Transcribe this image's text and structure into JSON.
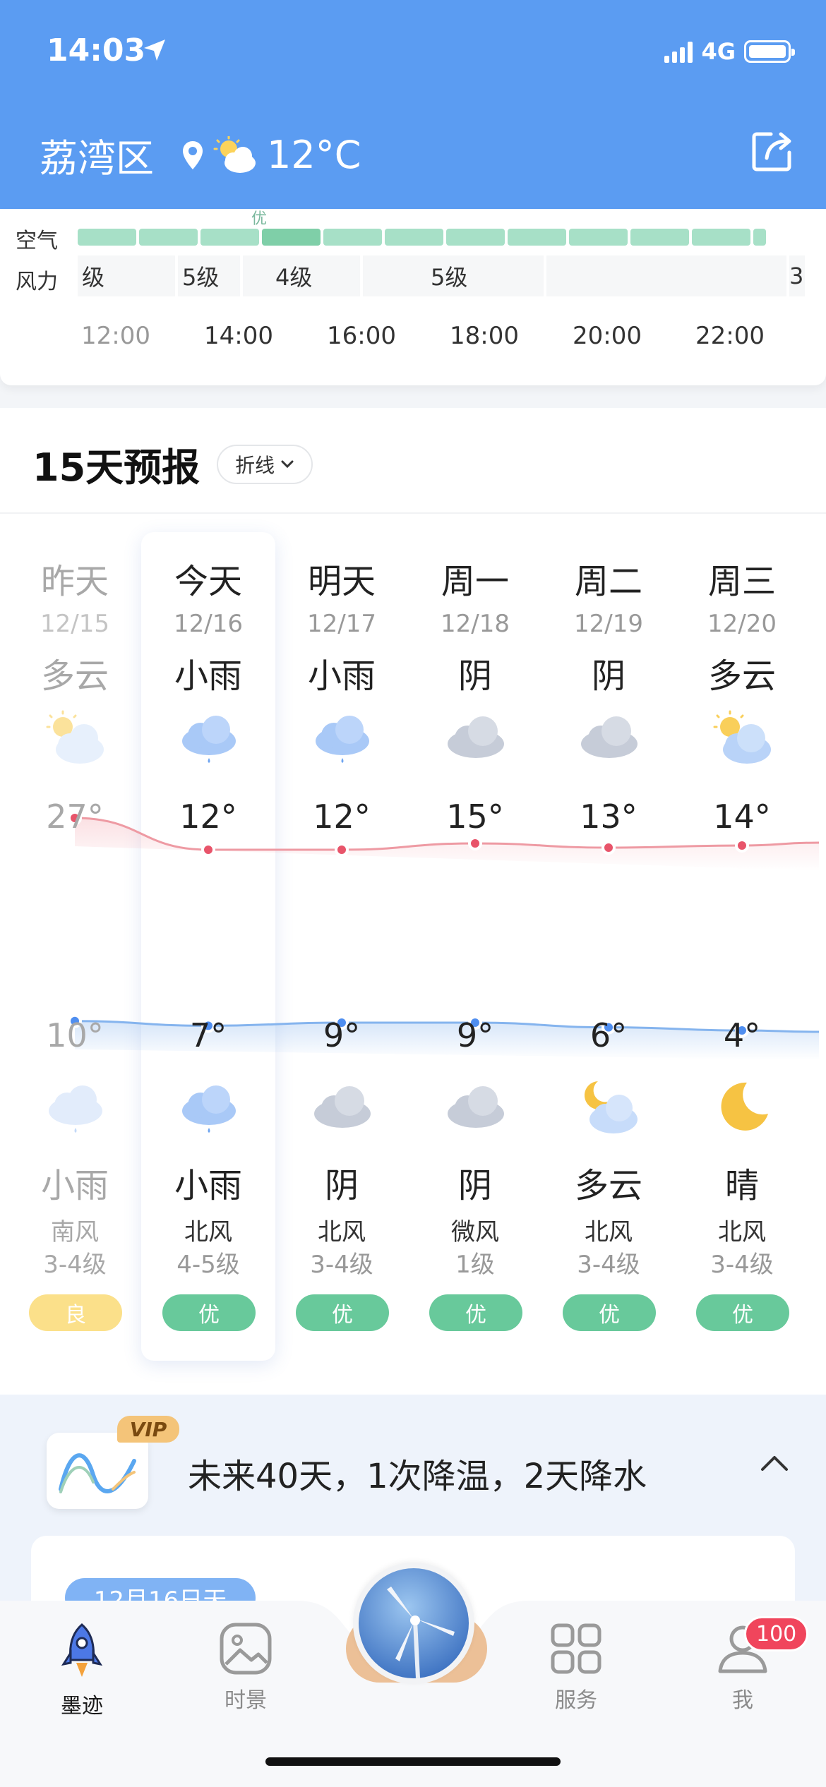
{
  "status_bar": {
    "time": "14:03",
    "network": "4G"
  },
  "header": {
    "location": "荔湾区",
    "temperature": "12°C"
  },
  "hourly": {
    "aq_peek_label": "优",
    "row_labels": {
      "air": "空气",
      "wind": "风力"
    },
    "wind_segments": [
      "级",
      "5级",
      "4级",
      "5级",
      "",
      "3"
    ],
    "hours": [
      "12:00",
      "14:00",
      "16:00",
      "18:00",
      "20:00",
      "22:00"
    ]
  },
  "forecast": {
    "title": "15天预报",
    "mode_label": "折线",
    "days": [
      {
        "name": "昨天",
        "date": "12/15",
        "day_cond": "多云",
        "day_icon": "partly-cloudy-icon",
        "high": "27°",
        "low": "10°",
        "night_cond": "小雨",
        "night_icon": "light-rain-icon",
        "wind_dir": "南风",
        "wind_level": "3-4级",
        "aqi": "良"
      },
      {
        "name": "今天",
        "date": "12/16",
        "day_cond": "小雨",
        "day_icon": "light-rain-icon",
        "high": "12°",
        "low": "7°",
        "night_cond": "小雨",
        "night_icon": "light-rain-icon",
        "wind_dir": "北风",
        "wind_level": "4-5级",
        "aqi": "优"
      },
      {
        "name": "明天",
        "date": "12/17",
        "day_cond": "小雨",
        "day_icon": "light-rain-icon",
        "high": "12°",
        "low": "9°",
        "night_cond": "阴",
        "night_icon": "overcast-icon",
        "wind_dir": "北风",
        "wind_level": "3-4级",
        "aqi": "优"
      },
      {
        "name": "周一",
        "date": "12/18",
        "day_cond": "阴",
        "day_icon": "overcast-icon",
        "high": "15°",
        "low": "9°",
        "night_cond": "阴",
        "night_icon": "overcast-icon",
        "wind_dir": "微风",
        "wind_level": "1级",
        "aqi": "优"
      },
      {
        "name": "周二",
        "date": "12/19",
        "day_cond": "阴",
        "day_icon": "overcast-icon",
        "high": "13°",
        "low": "6°",
        "night_cond": "多云",
        "night_icon": "night-partly-cloudy-icon",
        "wind_dir": "北风",
        "wind_level": "3-4级",
        "aqi": "优"
      },
      {
        "name": "周三",
        "date": "12/20",
        "day_cond": "多云",
        "day_icon": "partly-cloudy-icon",
        "high": "14°",
        "low": "4°",
        "night_cond": "晴",
        "night_icon": "moon-icon",
        "wind_dir": "北风",
        "wind_level": "3-4级",
        "aqi": "优"
      }
    ],
    "high_values": [
      27,
      12,
      12,
      15,
      13,
      14
    ],
    "low_values": [
      10,
      7,
      9,
      9,
      6,
      4
    ],
    "colors": {
      "high_line": "#ee9aa3",
      "high_dot": "#e8546a",
      "low_line": "#85b4ee",
      "low_dot": "#4f8ef0",
      "aqi_good": "#fbe08a",
      "aqi_excellent": "#68c99b"
    }
  },
  "long_range": {
    "vip_label": "VIP",
    "summary": "未来40天，1次降温，2天降水",
    "pill_text": "12月16日天"
  },
  "tabbar": {
    "tabs": [
      {
        "label": "墨迹",
        "icon": "rocket-icon"
      },
      {
        "label": "时景",
        "icon": "image-icon"
      },
      {
        "label": "服务",
        "icon": "grid-icon"
      },
      {
        "label": "我",
        "icon": "profile-icon"
      }
    ],
    "center_icon": "wind-turbine-icon",
    "badge_count": "100"
  }
}
